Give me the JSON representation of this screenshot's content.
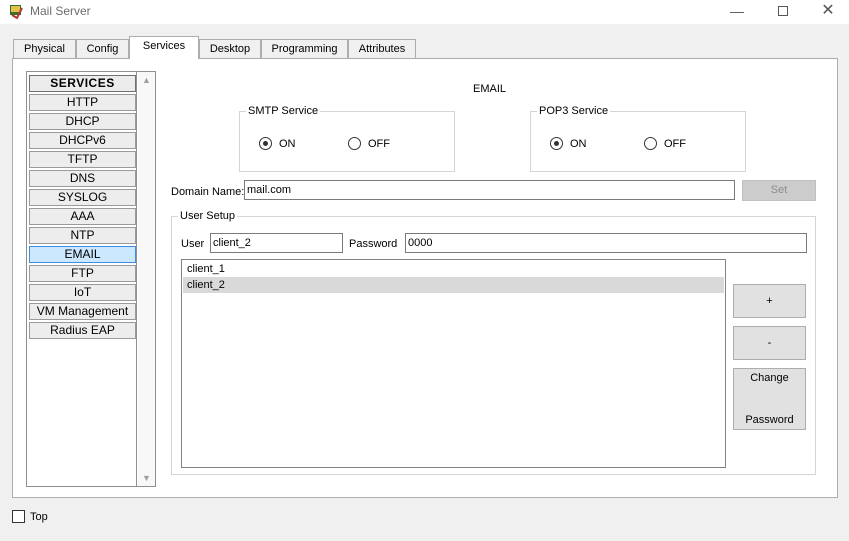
{
  "window": {
    "title": "Mail Server",
    "min_glyph": "—",
    "close_glyph": "✕"
  },
  "tabs": [
    {
      "label": "Physical"
    },
    {
      "label": "Config"
    },
    {
      "label": "Services",
      "active": true
    },
    {
      "label": "Desktop"
    },
    {
      "label": "Programming"
    },
    {
      "label": "Attributes"
    }
  ],
  "sidebar": {
    "header": "SERVICES",
    "items": [
      {
        "label": "HTTP"
      },
      {
        "label": "DHCP"
      },
      {
        "label": "DHCPv6"
      },
      {
        "label": "TFTP"
      },
      {
        "label": "DNS"
      },
      {
        "label": "SYSLOG"
      },
      {
        "label": "AAA"
      },
      {
        "label": "NTP"
      },
      {
        "label": "EMAIL",
        "selected": true
      },
      {
        "label": "FTP"
      },
      {
        "label": "IoT"
      },
      {
        "label": "VM Management"
      },
      {
        "label": "Radius EAP"
      }
    ]
  },
  "email": {
    "title": "EMAIL",
    "smtp": {
      "label": "SMTP Service",
      "on_label": "ON",
      "off_label": "OFF",
      "selected": "ON"
    },
    "pop3": {
      "label": "POP3 Service",
      "on_label": "ON",
      "off_label": "OFF",
      "selected": "ON"
    },
    "domain": {
      "label": "Domain Name:",
      "value": "mail.com",
      "set_label": "Set"
    },
    "user_setup": {
      "label": "User Setup",
      "user_label": "User",
      "user_value": "client_2",
      "password_label": "Password",
      "password_value": "0000",
      "users": [
        "client_1",
        "client_2"
      ],
      "selected_user": "client_2",
      "add_label": "+",
      "remove_label": "-",
      "change_password_label": [
        "Change",
        "Password"
      ]
    }
  },
  "footer": {
    "top_label": "Top",
    "top_checked": false
  }
}
